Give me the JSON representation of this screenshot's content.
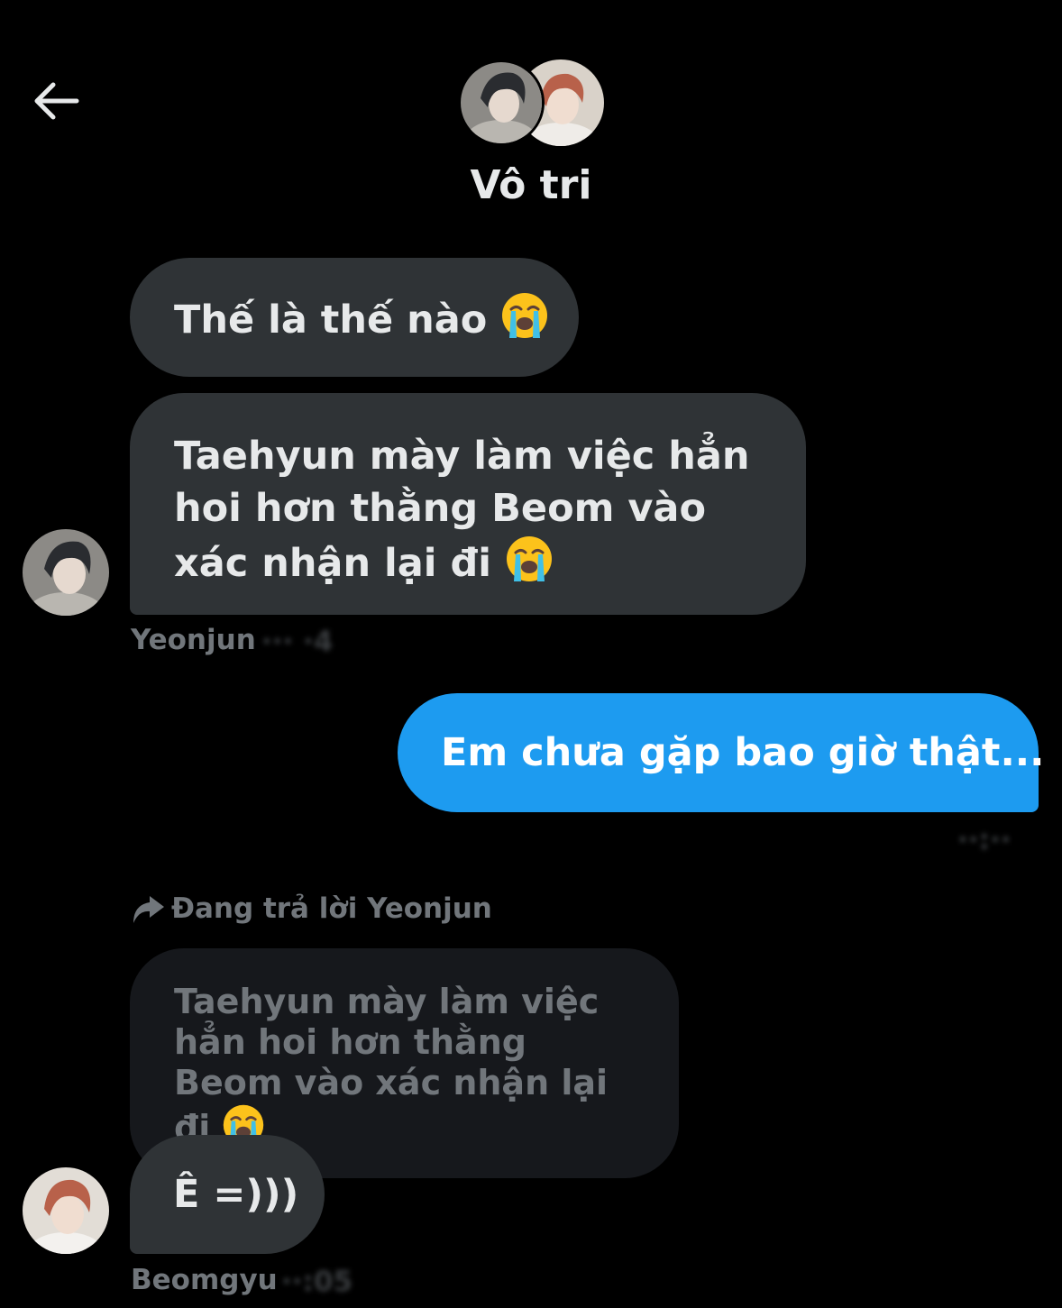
{
  "header": {
    "back_icon": "arrow-left-icon",
    "title": "Vô tri"
  },
  "messages": [
    {
      "text": "Thế là thế nào",
      "emoji": "loudly-crying-face"
    },
    {
      "text": "Taehyun mày làm việc hẳn hoi hơn thằng Beom vào xác nhận lại đi",
      "emoji": "loudly-crying-face",
      "sender": "Yeonjun"
    },
    {
      "text": "Em chưa gặp bao giờ thật...",
      "outgoing": true
    },
    {
      "reply_label": "Đang trả lời Yeonjun",
      "quoted_text": "Taehyun mày làm việc hẳn hoi hơn thằng Beom vào xác nhận lại đi",
      "quoted_emoji": "loudly-crying-face",
      "text": "Ê =)))",
      "sender": "Beomgyu"
    }
  ],
  "colors": {
    "background": "#000000",
    "incoming_bubble": "#2f3336",
    "outgoing_bubble": "#1d9bf0",
    "quoted_bubble": "#16181c",
    "muted_text": "#71767b"
  }
}
